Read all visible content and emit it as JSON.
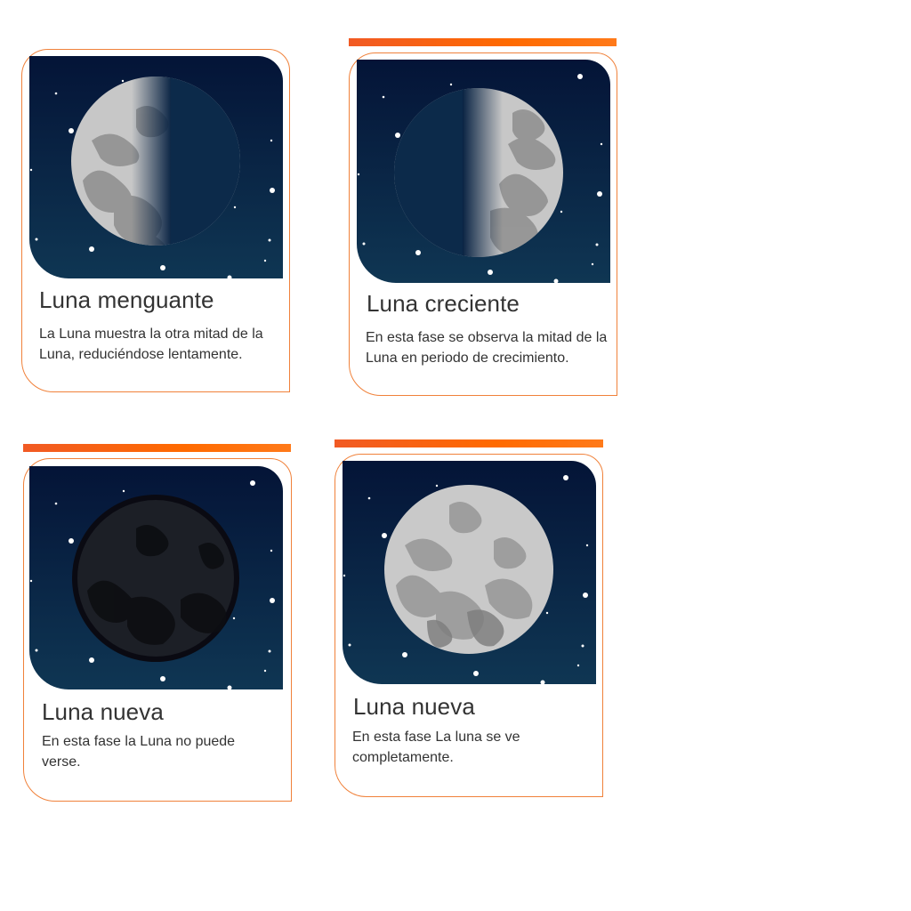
{
  "accent_color": "#ff6a00",
  "border_color": "#f0813a",
  "sky_colors": [
    "#041437",
    "#0f3653"
  ],
  "cards": [
    {
      "phase": "waning",
      "moon_icon": "waning-moon-icon",
      "title": "Luna menguante",
      "description": "La Luna muestra la otra mitad de la Luna, reduciéndose lentamente."
    },
    {
      "phase": "waxing",
      "moon_icon": "waxing-moon-icon",
      "title": "Luna creciente",
      "description": "En esta fase se observa la mitad de la Luna en periodo de crecimiento."
    },
    {
      "phase": "new",
      "moon_icon": "new-moon-icon",
      "title": "Luna nueva",
      "description": "En esta fase la Luna no puede verse."
    },
    {
      "phase": "full",
      "moon_icon": "full-moon-icon",
      "title": "Luna nueva",
      "description": "En esta fase La luna se ve completamente."
    }
  ]
}
